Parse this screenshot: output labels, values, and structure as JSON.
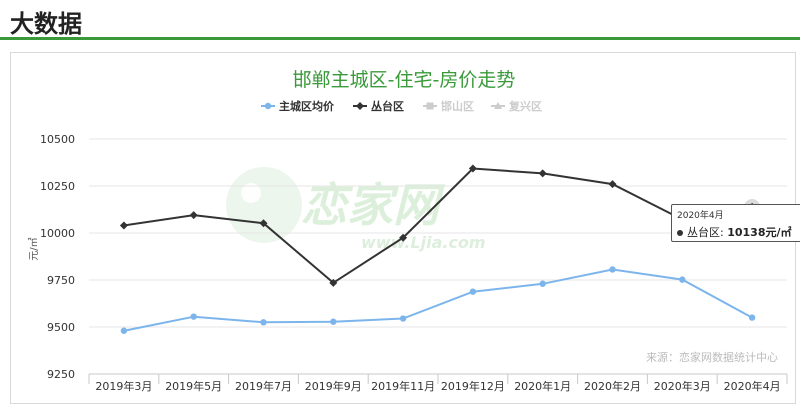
{
  "header": {
    "title": "大数据"
  },
  "chart_data": {
    "type": "line",
    "title": "邯郸主城区-住宅-房价走势",
    "ylabel": "元/㎡",
    "xlabel": "",
    "categories": [
      "2019年3月",
      "2019年5月",
      "2019年7月",
      "2019年9月",
      "2019年11月",
      "2019年12月",
      "2020年1月",
      "2020年2月",
      "2020年3月",
      "2020年4月"
    ],
    "ylim": [
      9250,
      10500
    ],
    "yticks": [
      9250,
      9500,
      9750,
      10000,
      10250,
      10500
    ],
    "ytick_labels": [
      "9250",
      "9500",
      "9750",
      "10000",
      "10250",
      "10500"
    ],
    "series": [
      {
        "name": "主城区均价",
        "color": "#7cb5ec",
        "marker": "circle",
        "visible": true,
        "values": [
          9480,
          9555,
          9525,
          9528,
          9545,
          9688,
          9730,
          9806,
          9752,
          9550
        ]
      },
      {
        "name": "丛台区",
        "color": "#333333",
        "marker": "diamond",
        "visible": true,
        "values": [
          10040,
          10095,
          10052,
          9735,
          9975,
          10343,
          10317,
          10260,
          10072,
          10138
        ]
      },
      {
        "name": "邯山区",
        "color": "#cccccc",
        "marker": "square",
        "visible": false,
        "values": []
      },
      {
        "name": "复兴区",
        "color": "#cccccc",
        "marker": "triangle",
        "visible": false,
        "values": []
      }
    ],
    "legend_position": "top-center",
    "grid": true,
    "source": "来源：恋家网数据统计中心",
    "watermark": {
      "text": "恋家网",
      "url": "www.Ljia.com"
    },
    "tooltip": {
      "date": "2020年4月",
      "series": "丛台区",
      "label": "丛台区:",
      "value": "10138元/㎡"
    }
  }
}
